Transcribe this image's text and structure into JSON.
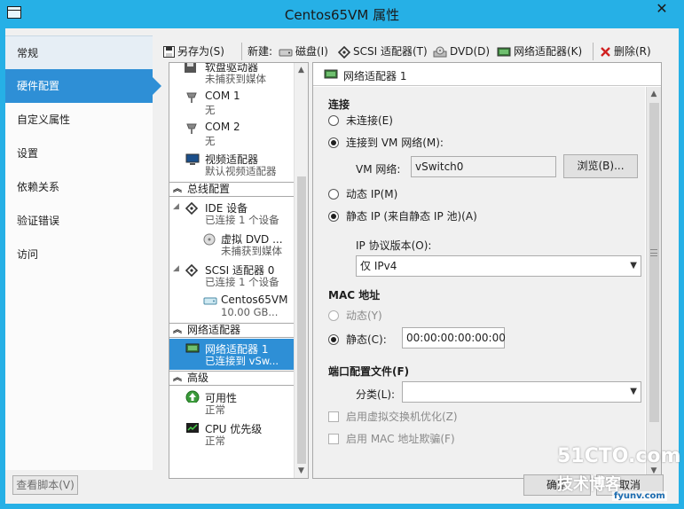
{
  "window": {
    "title": "Centos65VM 属性",
    "close_glyph": "✕"
  },
  "nav": {
    "items": [
      {
        "label": "常规"
      },
      {
        "label": "硬件配置"
      },
      {
        "label": "自定义属性"
      },
      {
        "label": "设置"
      },
      {
        "label": "依赖关系"
      },
      {
        "label": "验证错误"
      },
      {
        "label": "访问"
      }
    ],
    "selected": "硬件配置"
  },
  "toolbar": {
    "save_as": "另存为(S)",
    "new_label": "新建:",
    "disk": "磁盘(I)",
    "scsi": "SCSI 适配器(T)",
    "dvd": "DVD(D)",
    "network": "网络适配器(K)",
    "delete": "删除(R)"
  },
  "tree": {
    "partial_top": {
      "name": "软盘驱动器",
      "sub": "未捕获到媒体"
    },
    "com1": {
      "name": "COM 1",
      "sub": "无"
    },
    "com2": {
      "name": "COM 2",
      "sub": "无"
    },
    "video": {
      "name": "视频适配器",
      "sub": "默认视频适配器"
    },
    "section_bus": "总线配置",
    "ide": {
      "name": "IDE 设备",
      "sub": "已连接 1 个设备"
    },
    "dvd_drive": {
      "name": "虚拟 DVD ...",
      "sub": "未捕获到媒体"
    },
    "scsi": {
      "name": "SCSI 适配器 0",
      "sub": "已连接 1 个设备"
    },
    "vhd": {
      "name": "Centos65VM",
      "sub": "10.00 GB..."
    },
    "section_net": "网络适配器",
    "nic": {
      "name": "网络适配器 1",
      "sub": "已连接到 vSw..."
    },
    "section_adv": "高级",
    "availability": {
      "name": "可用性",
      "sub": "正常"
    },
    "cpu_priority": {
      "name": "CPU 优先级",
      "sub": "正常"
    }
  },
  "panel": {
    "header": "网络适配器 1",
    "connection_group": "连接",
    "not_connected": "未连接(E)",
    "connected_vm_net": "连接到 VM 网络(M):",
    "vm_net_label": "VM 网络:",
    "vm_net_value": "vSwitch0",
    "browse": "浏览(B)...",
    "dynamic_ip": "动态 IP(M)",
    "static_ip": "静态 IP (来自静态 IP 池)(A)",
    "ip_proto_label": "IP 协议版本(O):",
    "ip_proto_value": "仅 IPv4",
    "mac_group": "MAC 地址",
    "mac_dynamic": "动态(Y)",
    "mac_static": "静态(C):",
    "mac_value": "00:00:00:00:00:00",
    "port_profile_group": "端口配置文件(F)",
    "category_label": "分类(L):",
    "category_value": "",
    "enable_vswitch_opt": "启用虚拟交换机优化(Z)",
    "enable_mac_spoof": "启用 MAC 地址欺骗(F)"
  },
  "footer": {
    "view_script": "查看脚本(V)",
    "ok": "确定",
    "cancel": "取消"
  },
  "watermark": {
    "line1": "51CTO.com",
    "line2": "技术博客",
    "line3": "fyunv.com"
  },
  "colors": {
    "title_bar": "#26b0e6",
    "selection": "#2e8fd6"
  }
}
